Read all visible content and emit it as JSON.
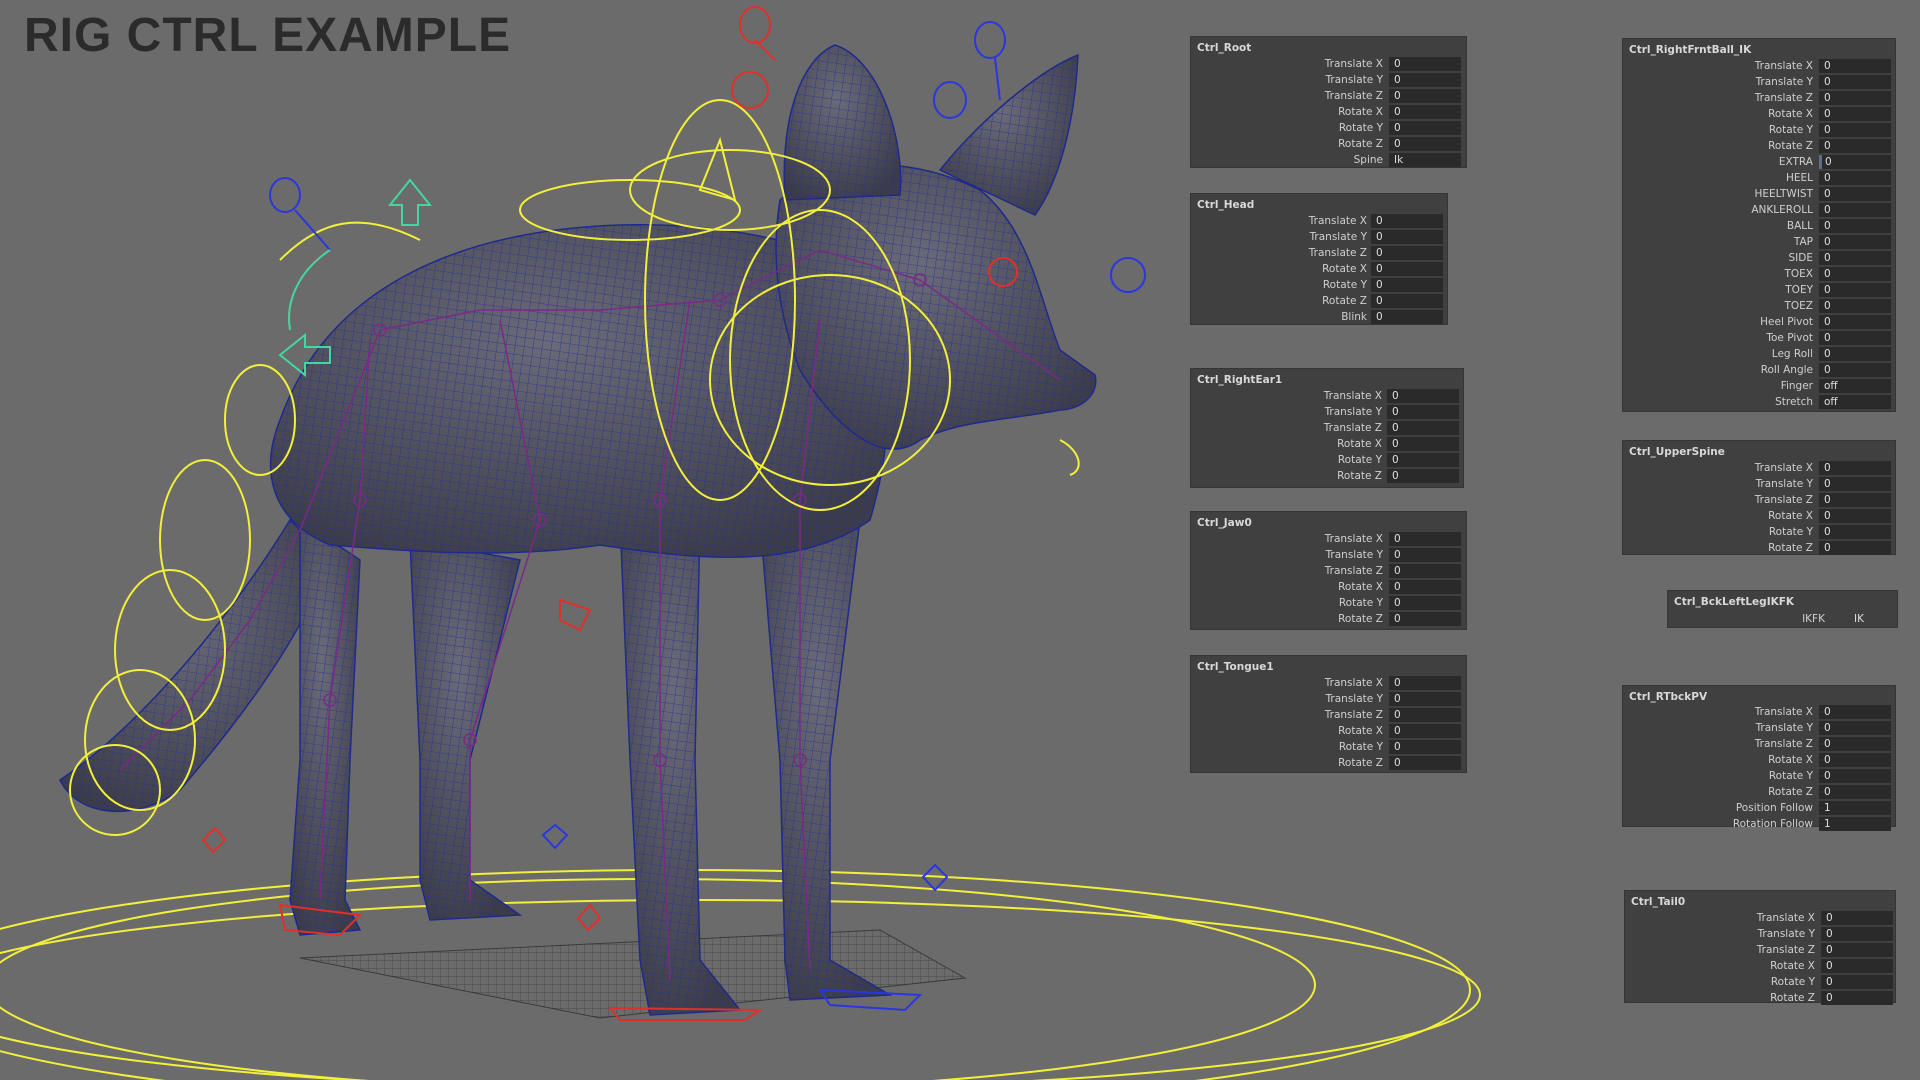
{
  "title": "RIG CTRL EXAMPLE",
  "panels": [
    {
      "id": "ctrl-root",
      "title": "Ctrl_Root",
      "rows": [
        {
          "label": "Translate X",
          "value": "0"
        },
        {
          "label": "Translate Y",
          "value": "0"
        },
        {
          "label": "Translate Z",
          "value": "0"
        },
        {
          "label": "Rotate X",
          "value": "0"
        },
        {
          "label": "Rotate Y",
          "value": "0"
        },
        {
          "label": "Rotate Z",
          "value": "0"
        },
        {
          "label": "Spine",
          "value": "Ik"
        }
      ]
    },
    {
      "id": "ctrl-head",
      "title": "Ctrl_Head",
      "rows": [
        {
          "label": "Translate X",
          "value": "0"
        },
        {
          "label": "Translate Y",
          "value": "0"
        },
        {
          "label": "Translate Z",
          "value": "0"
        },
        {
          "label": "Rotate X",
          "value": "0"
        },
        {
          "label": "Rotate Y",
          "value": "0"
        },
        {
          "label": "Rotate Z",
          "value": "0"
        },
        {
          "label": "Blink",
          "value": "0"
        }
      ]
    },
    {
      "id": "ctrl-right-ear1",
      "title": "Ctrl_RightEar1",
      "rows": [
        {
          "label": "Translate X",
          "value": "0"
        },
        {
          "label": "Translate Y",
          "value": "0"
        },
        {
          "label": "Translate Z",
          "value": "0"
        },
        {
          "label": "Rotate X",
          "value": "0"
        },
        {
          "label": "Rotate Y",
          "value": "0"
        },
        {
          "label": "Rotate Z",
          "value": "0"
        }
      ]
    },
    {
      "id": "ctrl-jaw0",
      "title": "Ctrl_Jaw0",
      "rows": [
        {
          "label": "Translate X",
          "value": "0"
        },
        {
          "label": "Translate Y",
          "value": "0"
        },
        {
          "label": "Translate Z",
          "value": "0"
        },
        {
          "label": "Rotate X",
          "value": "0"
        },
        {
          "label": "Rotate Y",
          "value": "0"
        },
        {
          "label": "Rotate Z",
          "value": "0"
        }
      ]
    },
    {
      "id": "ctrl-tongue1",
      "title": "Ctrl_Tongue1",
      "rows": [
        {
          "label": "Translate X",
          "value": "0"
        },
        {
          "label": "Translate Y",
          "value": "0"
        },
        {
          "label": "Translate Z",
          "value": "0"
        },
        {
          "label": "Rotate X",
          "value": "0"
        },
        {
          "label": "Rotate Y",
          "value": "0"
        },
        {
          "label": "Rotate Z",
          "value": "0"
        }
      ]
    },
    {
      "id": "ctrl-right-frnt-ball-ik",
      "title": "Ctrl_RightFrntBall_IK",
      "rows": [
        {
          "label": "Translate X",
          "value": "0"
        },
        {
          "label": "Translate Y",
          "value": "0"
        },
        {
          "label": "Translate Z",
          "value": "0"
        },
        {
          "label": "Rotate X",
          "value": "0"
        },
        {
          "label": "Rotate Y",
          "value": "0"
        },
        {
          "label": "Rotate Z",
          "value": "0"
        },
        {
          "label": "EXTRA",
          "value": "0"
        },
        {
          "label": "HEEL",
          "value": "0"
        },
        {
          "label": "HEELTWIST",
          "value": "0"
        },
        {
          "label": "ANKLEROLL",
          "value": "0"
        },
        {
          "label": "BALL",
          "value": "0"
        },
        {
          "label": "TAP",
          "value": "0"
        },
        {
          "label": "SIDE",
          "value": "0"
        },
        {
          "label": "TOEX",
          "value": "0"
        },
        {
          "label": "TOEY",
          "value": "0"
        },
        {
          "label": "TOEZ",
          "value": "0"
        },
        {
          "label": "Heel Pivot",
          "value": "0"
        },
        {
          "label": "Toe Pivot",
          "value": "0"
        },
        {
          "label": "Leg Roll",
          "value": "0"
        },
        {
          "label": "Roll Angle",
          "value": "0"
        },
        {
          "label": "Finger",
          "value": "off"
        },
        {
          "label": "Stretch",
          "value": "off"
        }
      ]
    },
    {
      "id": "ctrl-upper-spine",
      "title": "Ctrl_UpperSpine",
      "rows": [
        {
          "label": "Translate X",
          "value": "0"
        },
        {
          "label": "Translate Y",
          "value": "0"
        },
        {
          "label": "Translate Z",
          "value": "0"
        },
        {
          "label": "Rotate X",
          "value": "0"
        },
        {
          "label": "Rotate Y",
          "value": "0"
        },
        {
          "label": "Rotate Z",
          "value": "0"
        }
      ]
    },
    {
      "id": "ctrl-bck-left-leg-ikfk",
      "title": "Ctrl_BckLeftLegIKFK",
      "rows": [
        {
          "label": "IKFK",
          "value": "IK"
        }
      ]
    },
    {
      "id": "ctrl-rtbck-pv",
      "title": "Ctrl_RTbckPV",
      "rows": [
        {
          "label": "Translate X",
          "value": "0"
        },
        {
          "label": "Translate Y",
          "value": "0"
        },
        {
          "label": "Translate Z",
          "value": "0"
        },
        {
          "label": "Rotate X",
          "value": "0"
        },
        {
          "label": "Rotate Y",
          "value": "0"
        },
        {
          "label": "Rotate Z",
          "value": "0"
        },
        {
          "label": "Position Follow",
          "value": "1"
        },
        {
          "label": "Rotation Follow",
          "value": "1"
        }
      ]
    },
    {
      "id": "ctrl-tail0",
      "title": "Ctrl_Tail0",
      "rows": [
        {
          "label": "Translate X",
          "value": "0"
        },
        {
          "label": "Translate Y",
          "value": "0"
        },
        {
          "label": "Translate Z",
          "value": "0"
        },
        {
          "label": "Rotate X",
          "value": "0"
        },
        {
          "label": "Rotate Y",
          "value": "0"
        },
        {
          "label": "Rotate Z",
          "value": "0"
        }
      ]
    }
  ],
  "colors": {
    "background": "#6b6b6b",
    "panel": "#404040",
    "field": "#2a2a2a",
    "control_yellow": "#f2f03a",
    "control_red": "#e0302a",
    "control_blue": "#2a36e0",
    "control_green": "#44d6a0",
    "joint_purple": "#7a2a86"
  }
}
